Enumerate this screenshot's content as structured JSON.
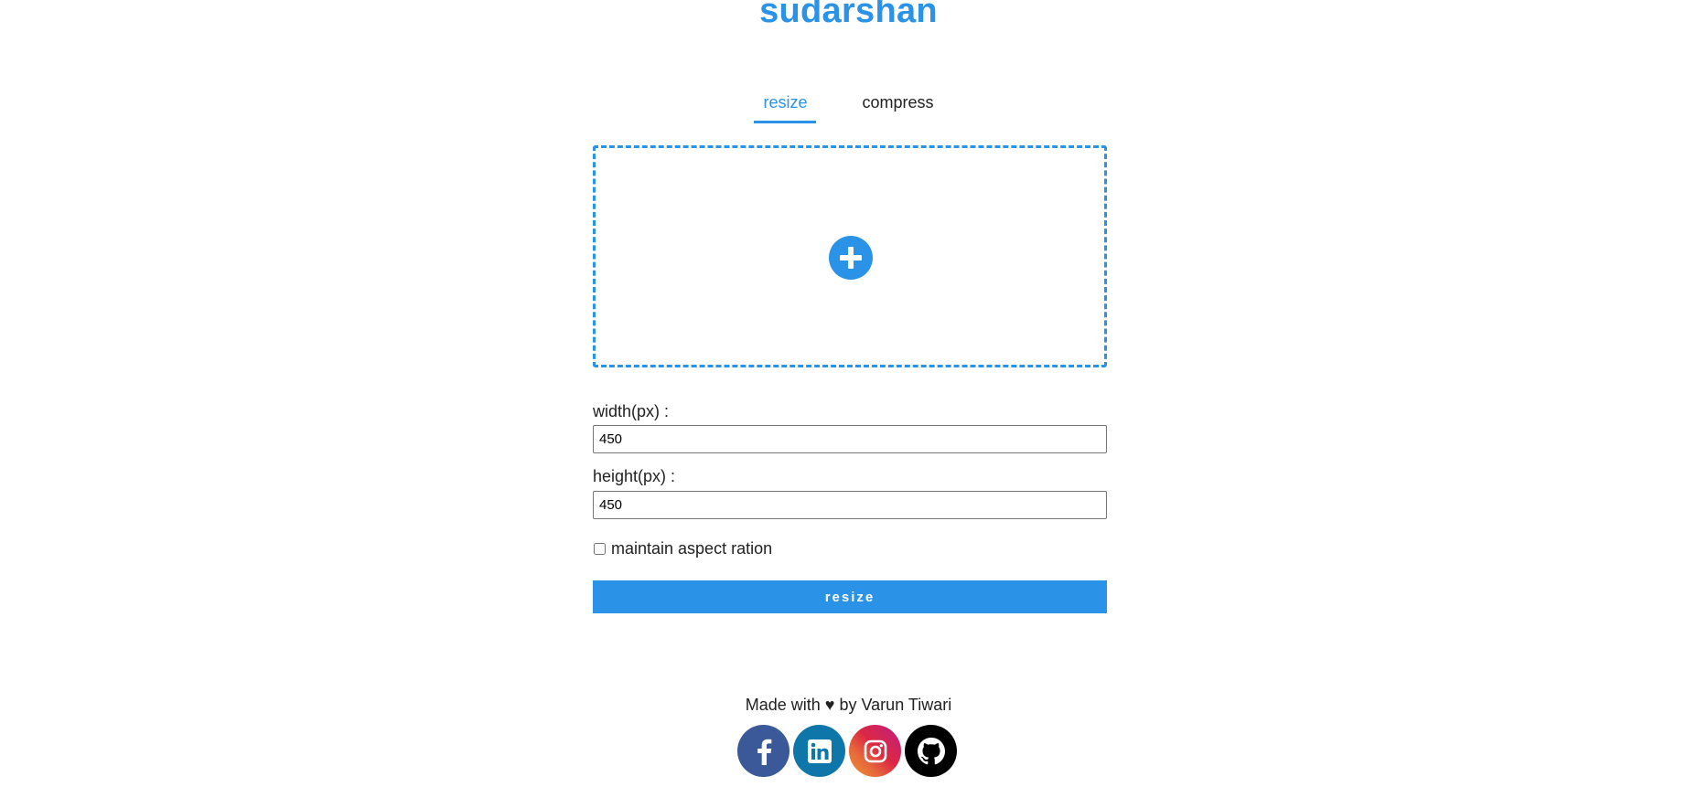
{
  "header": {
    "brand": "sudarshan"
  },
  "tabs": [
    {
      "label": "resize",
      "active": true
    },
    {
      "label": "compress",
      "active": false
    }
  ],
  "upload": {
    "icon": "plus-circle-icon"
  },
  "form": {
    "width_label": "width(px) :",
    "width_value": "450",
    "height_label": "height(px) :",
    "height_value": "450",
    "aspect_label": "maintain aspect ration",
    "aspect_checked": false,
    "submit_label": "resize"
  },
  "footer": {
    "credit": "Made with ♥ by Varun Tiwari",
    "socials": [
      {
        "name": "facebook",
        "icon": "facebook-icon",
        "color": "#3b5998"
      },
      {
        "name": "linkedin",
        "icon": "linkedin-icon",
        "color": "#0e76a8"
      },
      {
        "name": "instagram",
        "icon": "instagram-icon",
        "color": "#dc2743"
      },
      {
        "name": "github",
        "icon": "github-icon",
        "color": "#000000"
      }
    ]
  },
  "colors": {
    "accent": "#2a93e8",
    "text": "#222222"
  }
}
